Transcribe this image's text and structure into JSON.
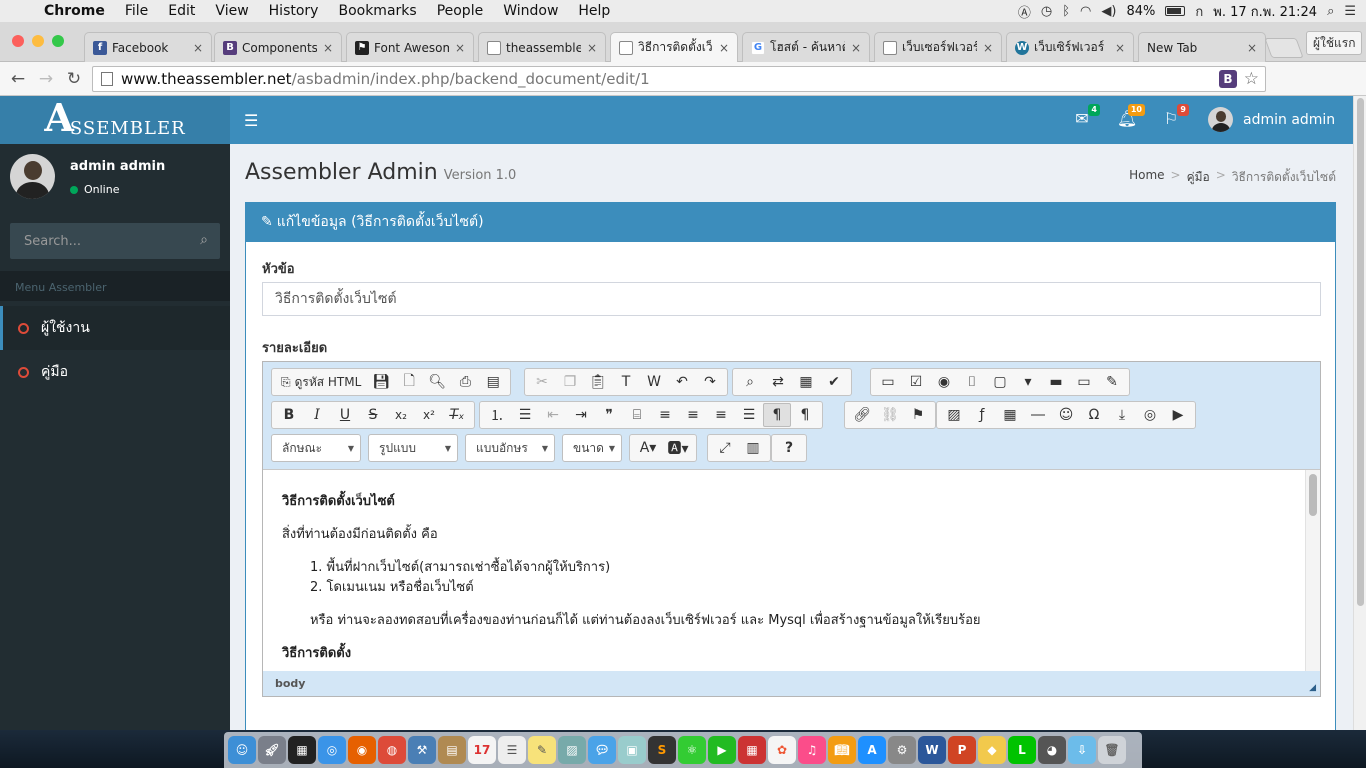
{
  "menubar": {
    "app": "Chrome",
    "items": [
      "File",
      "Edit",
      "View",
      "History",
      "Bookmarks",
      "People",
      "Window",
      "Help"
    ],
    "battery": "84%",
    "clock": "พ. 17 ก.พ. 21:24"
  },
  "tabs": [
    {
      "title": "Facebook",
      "icon_color": "#3b5998",
      "icon_glyph": "f"
    },
    {
      "title": "Components · ",
      "icon_color": "#563d7c",
      "icon_glyph": "B"
    },
    {
      "title": "Font Awesome",
      "icon_color": "#222222",
      "icon_glyph": "⚑"
    },
    {
      "title": "theassembler.n",
      "icon_color": "#ffffff",
      "icon_glyph": ""
    },
    {
      "title": "วิธีการติดตั้งเว็บไซ",
      "icon_color": "#ffffff",
      "icon_glyph": ""
    },
    {
      "title": "โฮสต์ - ค้นหาด้วย",
      "icon_color": "#4285f4",
      "icon_glyph": "G"
    },
    {
      "title": "เว็บเซอร์ฟเวอร์ ที่",
      "icon_color": "#ffffff",
      "icon_glyph": ""
    },
    {
      "title": "เว็บเซิร์ฟเวอร์ (We",
      "icon_color": "#21759b",
      "icon_glyph": "W"
    },
    {
      "title": "New Tab",
      "icon_color": "",
      "icon_glyph": ""
    }
  ],
  "profile_button": "ผู้ใช้แรก",
  "address": {
    "host": "www.theassembler.net",
    "path": "/asbadmin/index.php/backend_document/edit/1"
  },
  "header": {
    "logo_letter": "A",
    "logo_text": "SSEMBLER",
    "badges": {
      "messages": "4",
      "notifications": "10",
      "tasks": "9"
    },
    "badge_colors": {
      "messages": "#00a65a",
      "notifications": "#f39c12",
      "tasks": "#dd4b39"
    },
    "user_name": "admin admin"
  },
  "sidebar": {
    "user_name": "admin admin",
    "status": "Online",
    "search_placeholder": "Search...",
    "menu_header": "Menu Assembler",
    "items": [
      {
        "label": "ผู้ใช้งาน"
      },
      {
        "label": "คู่มือ"
      }
    ]
  },
  "content": {
    "title": "Assembler Admin",
    "version": "Version 1.0",
    "breadcrumb": [
      "Home",
      "คู่มือ",
      "วิธีการติดตั้งเว็บไซต์"
    ],
    "box_title": "แก้ไขข้อมูล (วิธีการติดตั้งเว็บไซต์)",
    "field_title_label": "หัวข้อ",
    "field_title_value": "วิธีการติดตั้งเว็บไซต์",
    "field_detail_label": "รายละเอียด"
  },
  "editor": {
    "source_label": "ดูรหัส HTML",
    "combos": [
      "ลักษณะ",
      "รูปแบบ",
      "แบบอักษร",
      "ขนาด"
    ],
    "body": {
      "heading": "วิธีการติดตั้งเว็บไซต์",
      "intro": "สิ่งที่ท่านต้องมีก่อนติดตั้ง คือ",
      "list": [
        "พื้นที่ฝากเว็บไซต์(สามารถเช่าซื้อได้จากผู้ให้บริการ)",
        "โดเมนเนม หรือชื่อเว็บไซต์"
      ],
      "note": "หรือ ท่านจะลองทดสอบที่เครื่องของท่านก่อนก็ได้ แต่ท่านต้องลงเว็บเซิร์ฟเวอร์ และ Mysql เพื่อสร้างฐานข้อมูลให้เรียบร้อย",
      "heading2": "วิธีการติดตั้ง"
    },
    "path_label": "body"
  }
}
